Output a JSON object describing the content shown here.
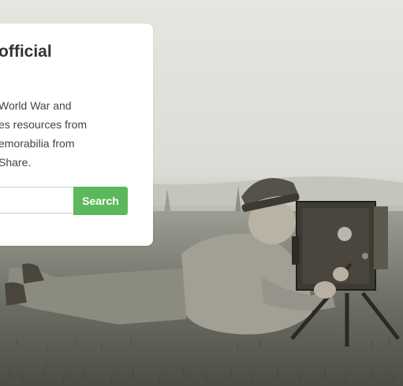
{
  "card": {
    "title": "official",
    "body_lines": [
      "World War and",
      "es resources from",
      "emorabilia from",
      "Share."
    ]
  },
  "search": {
    "placeholder": "",
    "value": "",
    "button_label": "Search"
  },
  "colors": {
    "accent": "#5cb85c",
    "card_background": "#ffffff",
    "title_text": "#333333"
  },
  "background_photo": "sepia photograph of a uniformed soldier lying in grass operating a box camera"
}
